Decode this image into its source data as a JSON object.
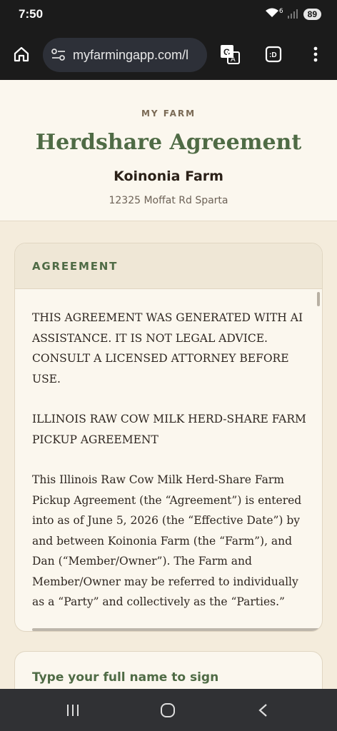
{
  "status_bar": {
    "time": "7:50",
    "network": "6",
    "battery": "89"
  },
  "browser": {
    "url": "myfarmingapp.com/l"
  },
  "header": {
    "kicker": "MY FARM",
    "title": "Herdshare Agreement",
    "farm_name": "Koinonia Farm",
    "address": "12325 Moffat Rd Sparta"
  },
  "agreement": {
    "heading": "AGREEMENT",
    "paragraphs": [
      "THIS AGREEMENT WAS GENERATED WITH AI ASSISTANCE. IT IS NOT LEGAL ADVICE. CONSULT A LICENSED ATTORNEY BEFORE USE.",
      "ILLINOIS RAW COW MILK HERD-SHARE FARM PICKUP AGREEMENT",
      "This Illinois Raw Cow Milk Herd-Share Farm Pickup Agreement (the “Agreement”) is entered into as of June 5, 2026 (the “Effective Date”) by and between Koinonia Farm (the “Farm”), and Dan (“Member/Owner”). The Farm and Member/Owner may be referred to individually as a “Party” and collectively as the “Parties.”"
    ]
  },
  "signature": {
    "label": "Type your full name to sign"
  }
}
